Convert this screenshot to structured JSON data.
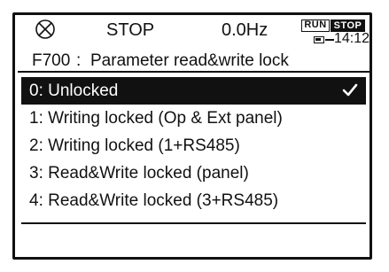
{
  "status_bar": {
    "status_icon": "circle-x-icon",
    "state": "STOP",
    "frequency": "0.0Hz",
    "mode_run": "RUN",
    "mode_stop": "STOP",
    "battery_icon": "battery-icon",
    "time": "14:12"
  },
  "header": {
    "code": "F700",
    "separator": ":",
    "title": "Parameter read&write lock"
  },
  "options": [
    {
      "label": "0: Unlocked",
      "selected": true
    },
    {
      "label": "1: Writing locked (Op & Ext panel)",
      "selected": false
    },
    {
      "label": "2: Writing locked (1+RS485)",
      "selected": false
    },
    {
      "label": "3: Read&Write locked (panel)",
      "selected": false
    },
    {
      "label": "4: Read&Write locked (3+RS485)",
      "selected": false
    }
  ],
  "selected_icon": "checkmark-icon",
  "colors": {
    "foreground": "#111111",
    "background": "#ffffff",
    "selection": "#111111"
  }
}
